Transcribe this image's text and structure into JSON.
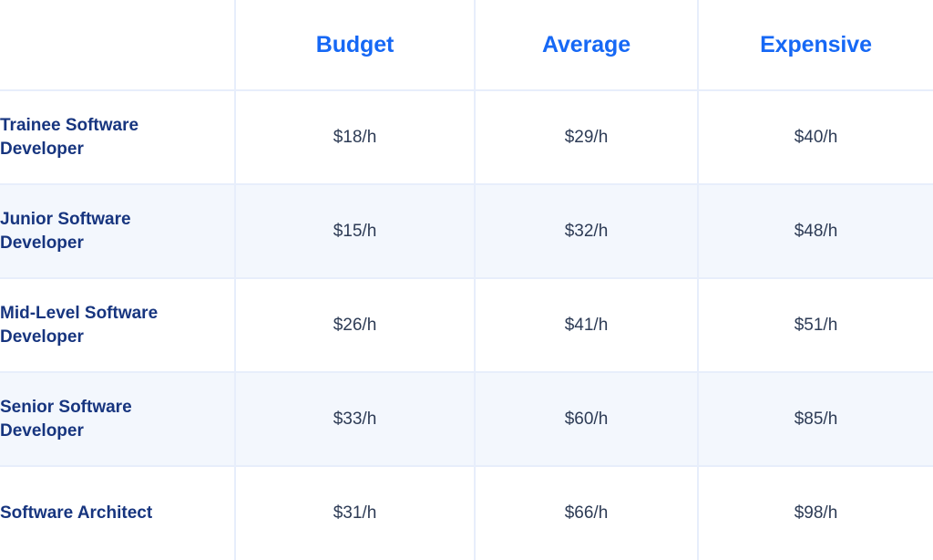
{
  "table": {
    "columns": [
      {
        "key": "role",
        "label": ""
      },
      {
        "key": "budget",
        "label": "Budget"
      },
      {
        "key": "average",
        "label": "Average"
      },
      {
        "key": "expensive",
        "label": "Expensive"
      }
    ],
    "rows": [
      {
        "role": "Trainee Software Developer",
        "budget": "$18/h",
        "average": "$29/h",
        "expensive": "$40/h"
      },
      {
        "role": "Junior Software Developer",
        "budget": "$15/h",
        "average": "$32/h",
        "expensive": "$48/h"
      },
      {
        "role": "Mid-Level Software Developer",
        "budget": "$26/h",
        "average": "$41/h",
        "expensive": "$51/h"
      },
      {
        "role": "Senior Software Developer",
        "budget": "$33/h",
        "average": "$60/h",
        "expensive": "$85/h"
      },
      {
        "role": "Software Architect",
        "budget": "$31/h",
        "average": "$66/h",
        "expensive": "$98/h"
      }
    ]
  },
  "colors": {
    "header_text": "#1668f5",
    "role_text": "#17357f",
    "value_text": "#2d3b55",
    "border": "#e7eefb",
    "row_alt_background": "#f3f7fd",
    "row_background": "#ffffff"
  }
}
